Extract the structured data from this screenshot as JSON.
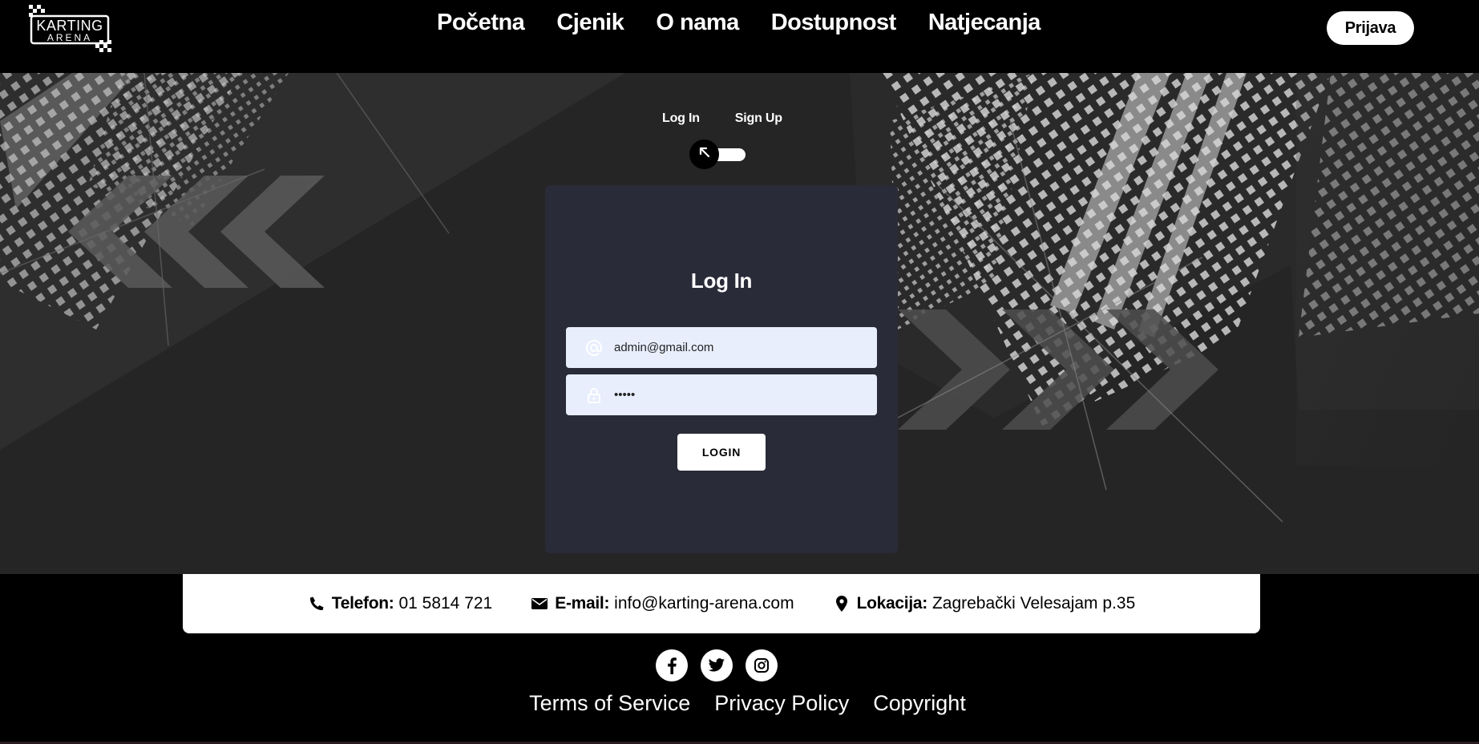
{
  "header": {
    "logo_top": "KARTING",
    "logo_bottom": "ARENA",
    "nav": [
      {
        "label": "Početna"
      },
      {
        "label": "Cjenik"
      },
      {
        "label": "O nama"
      },
      {
        "label": "Dostupnost"
      },
      {
        "label": "Natjecanja"
      }
    ],
    "login_button": "Prijava"
  },
  "auth": {
    "toggle_login_label": "Log In",
    "toggle_signup_label": "Sign Up",
    "toggle_icon": "arrow-up-left-icon",
    "form_title": "Log In",
    "email_value": "admin@gmail.com",
    "email_icon": "at-icon",
    "password_value": "admin",
    "password_icon": "lock-icon",
    "submit_label": "LOGIN"
  },
  "contact": {
    "phone_label": "Telefon:",
    "phone_value": "01 5814 721",
    "email_label": "E-mail:",
    "email_value": "info@karting-arena.com",
    "location_label": "Lokacija:",
    "location_value": "Zagrebački Velesajam p.35"
  },
  "socials": [
    "facebook-icon",
    "twitter-icon",
    "instagram-icon"
  ],
  "footer": {
    "links": [
      {
        "label": "Terms of Service"
      },
      {
        "label": "Privacy Policy"
      },
      {
        "label": "Copyright"
      }
    ]
  },
  "colors": {
    "card_bg": "#2a2b38",
    "input_bg": "#e8eefc",
    "hero_bg": "#242424"
  }
}
